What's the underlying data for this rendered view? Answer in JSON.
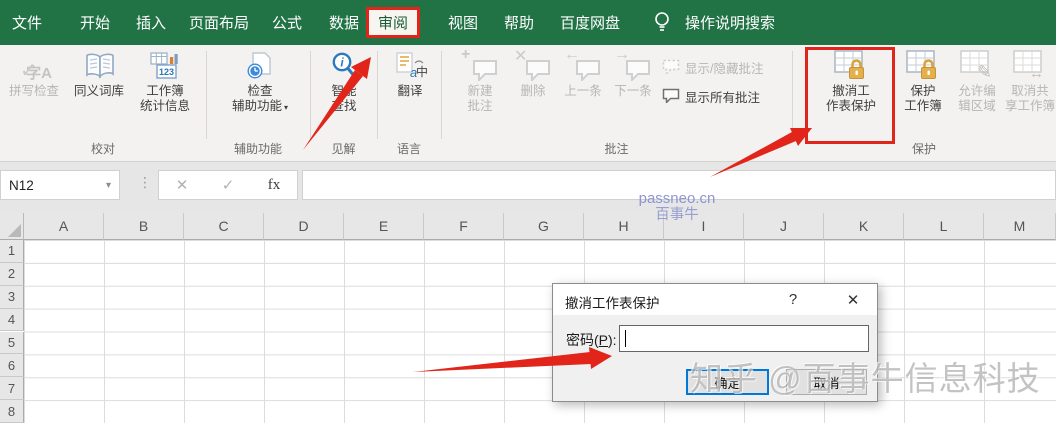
{
  "colors": {
    "excel_green": "#217346",
    "annotation_red": "#E1251B",
    "focus_blue": "#0078D7",
    "watermark_blue": "#7C85CB"
  },
  "icons": {
    "bulb": "lightbulb",
    "chevron_down": "▾",
    "name_box_dropdown": "▾",
    "more_dots": "⋮",
    "formula_cancel": "✕",
    "formula_enter": "✓",
    "insert_function": "fx",
    "comment_new": "+",
    "comment_delete": "✕",
    "comment_prev": "←",
    "comment_next": "→",
    "pencil": "✎",
    "share_arrows": "↔",
    "dialog_help": "?",
    "dialog_close": "✕",
    "spell_glyph": "字A",
    "spell_check": "✓"
  },
  "menubar": {
    "tabs": [
      {
        "label": "文件"
      },
      {
        "label": "开始"
      },
      {
        "label": "插入"
      },
      {
        "label": "页面布局"
      },
      {
        "label": "公式"
      },
      {
        "label": "数据"
      },
      {
        "label": "审阅",
        "active": true,
        "highlighted": true
      },
      {
        "label": "视图"
      },
      {
        "label": "帮助"
      },
      {
        "label": "百度网盘"
      }
    ],
    "tell_me": "操作说明搜索"
  },
  "ribbon": {
    "groups": [
      {
        "label": "校对",
        "buttons": [
          {
            "label": "拼写检查",
            "enabled": false
          },
          {
            "label": "同义词库",
            "enabled": true
          },
          {
            "label": "工作簿\n统计信息",
            "enabled": true
          }
        ]
      },
      {
        "label": "辅助功能",
        "buttons": [
          {
            "label": "检查\n辅助功能",
            "enabled": true,
            "dropdown": true
          }
        ]
      },
      {
        "label": "见解",
        "buttons": [
          {
            "label": "智能\n查找",
            "enabled": true
          }
        ]
      },
      {
        "label": "语言",
        "buttons": [
          {
            "label": "翻译",
            "enabled": true
          }
        ]
      },
      {
        "label": "批注",
        "buttons": [
          {
            "label": "新建\n批注",
            "enabled": false
          },
          {
            "label": "删除",
            "enabled": false
          },
          {
            "label": "上一条",
            "enabled": false
          },
          {
            "label": "下一条",
            "enabled": false
          },
          {
            "label": "显示/隐藏批注",
            "enabled": false
          },
          {
            "label": "显示所有批注",
            "enabled": true
          }
        ]
      },
      {
        "label": "保护",
        "buttons": [
          {
            "label": "撤消工\n作表保护",
            "enabled": true,
            "highlighted": true
          },
          {
            "label": "保护\n工作簿",
            "enabled": true
          },
          {
            "label": "允许编\n辑区域",
            "enabled": false
          },
          {
            "label": "取消共\n享工作簿",
            "enabled": false
          }
        ]
      }
    ]
  },
  "formula_bar": {
    "name_box_value": "N12",
    "formula_value": ""
  },
  "sheet": {
    "column_headers": [
      "A",
      "B",
      "C",
      "D",
      "E",
      "F",
      "G",
      "H",
      "I",
      "J",
      "K",
      "L",
      "M"
    ],
    "row_headers": [
      "1",
      "2",
      "3",
      "4",
      "5",
      "6",
      "7",
      "8"
    ]
  },
  "dialog": {
    "title": "撤消工作表保护",
    "help_button": "?",
    "close_button": "✕",
    "password_label_prefix": "密码(",
    "password_label_key": "P",
    "password_label_suffix": "):",
    "password_value": "",
    "ok_button": "确定",
    "cancel_button": "取消"
  },
  "watermarks": {
    "formula_line1": "passneo.cn",
    "formula_line2": "百事牛",
    "bottom_right": "知乎 @百事牛信息科技"
  }
}
